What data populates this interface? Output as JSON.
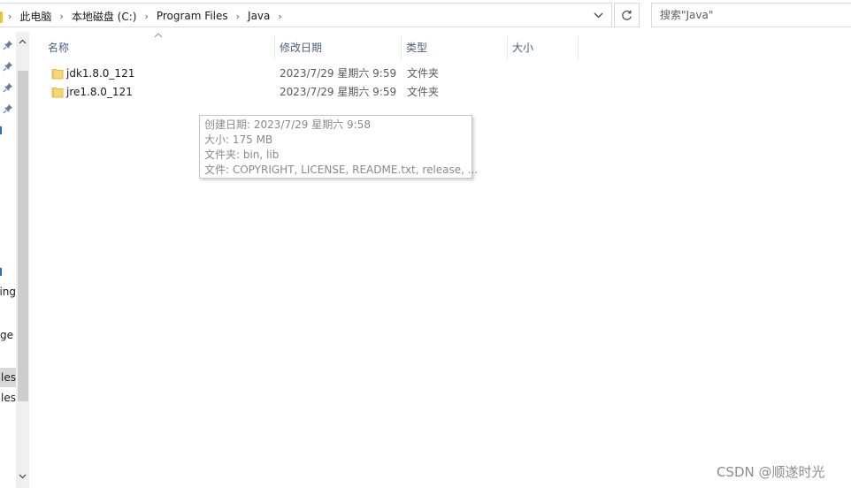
{
  "address_bar": {
    "crumbs": [
      "此电脑",
      "本地磁盘 (C:)",
      "Program Files",
      "Java"
    ]
  },
  "search": {
    "placeholder": "搜索\"Java\""
  },
  "nav_pane": {
    "labels": [
      "tting",
      "ge",
      "iles",
      "iles"
    ]
  },
  "columns": [
    {
      "label": "名称"
    },
    {
      "label": "修改日期"
    },
    {
      "label": "类型"
    },
    {
      "label": "大小"
    }
  ],
  "rows": [
    {
      "name": "jdk1.8.0_121",
      "date": "2023/7/29 星期六 9:59",
      "type": "文件夹",
      "size": ""
    },
    {
      "name": "jre1.8.0_121",
      "date": "2023/7/29 星期六 9:59",
      "type": "文件夹",
      "size": ""
    }
  ],
  "tooltip": {
    "lines": [
      "创建日期: 2023/7/29 星期六 9:58",
      "大小: 175 MB",
      "文件夹: bin, lib",
      "文件: COPYRIGHT, LICENSE, README.txt, release, ..."
    ]
  },
  "watermark": "CSDN @顺遂时光",
  "colors": {
    "folder": "#f5d77a",
    "folder_edge": "#e3b94a",
    "header_text": "#4c607a"
  },
  "icons": {
    "folder": "folder-icon",
    "pin": "pin-icon",
    "refresh": "refresh-icon"
  }
}
